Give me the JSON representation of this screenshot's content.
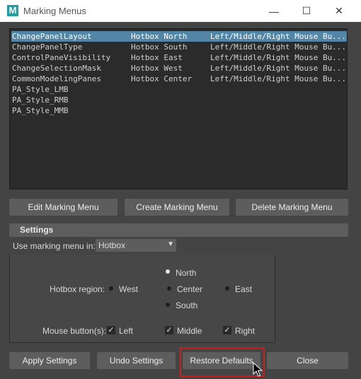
{
  "window": {
    "title": "Marking Menus",
    "app_icon_letter": "M",
    "minimize_glyph": "—",
    "maximize_glyph": "☐",
    "close_glyph": "✕"
  },
  "menus": [
    {
      "name": "ChangePanelLayout",
      "location": "Hotbox North",
      "buttons": "Left/Middle/Right Mouse Bu...",
      "selected": true
    },
    {
      "name": "ChangePanelType",
      "location": "Hotbox South",
      "buttons": "Left/Middle/Right Mouse Bu..."
    },
    {
      "name": "ControlPaneVisibility",
      "location": "Hotbox East",
      "buttons": "Left/Middle/Right Mouse Bu..."
    },
    {
      "name": "ChangeSelectionMask",
      "location": "Hotbox West",
      "buttons": "Left/Middle/Right Mouse Bu..."
    },
    {
      "name": "CommonModelingPanes",
      "location": "Hotbox Center",
      "buttons": "Left/Middle/Right Mouse Bu..."
    },
    {
      "name": "PA_Style_LMB",
      "location": "",
      "buttons": ""
    },
    {
      "name": "PA_Style_RMB",
      "location": "",
      "buttons": ""
    },
    {
      "name": "PA_Style_MMB",
      "location": "",
      "buttons": ""
    }
  ],
  "actions": {
    "edit": "Edit Marking Menu",
    "create": "Create Marking Menu",
    "delete": "Delete Marking Menu"
  },
  "settings": {
    "title": "Settings",
    "use_in_label": "Use marking menu in:",
    "use_in_value": "Hotbox",
    "region_label": "Hotbox region:",
    "regions": {
      "north": "North",
      "west": "West",
      "center": "Center",
      "east": "East",
      "south": "South"
    },
    "selected_region": "North",
    "mouse_label": "Mouse button(s):",
    "mouse": {
      "left": "Left",
      "middle": "Middle",
      "right": "Right"
    },
    "mouse_checked": {
      "left": true,
      "middle": true,
      "right": true
    }
  },
  "footer": {
    "apply": "Apply Settings",
    "undo": "Undo Settings",
    "restore": "Restore Defaults",
    "close": "Close"
  },
  "colors": {
    "background": "#444444",
    "list_background": "#2b2b2b",
    "selection": "#5285a6",
    "button": "#5d5d5d",
    "highlight_box": "#c5221f",
    "app_icon": "#1ea0a6"
  }
}
